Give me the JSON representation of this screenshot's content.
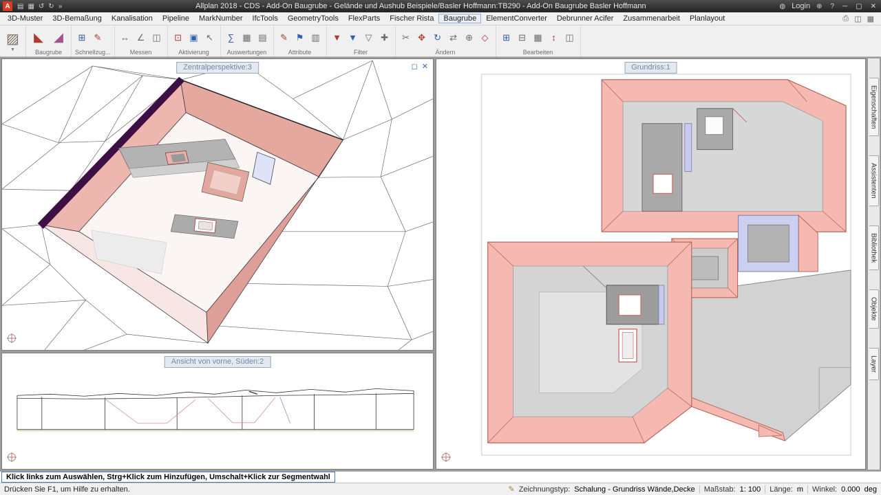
{
  "colors": {
    "wall_pink": "#f6b9b1",
    "wall_salmon": "#e4a89f",
    "rim_purple": "#3d0f45",
    "floor_gray": "#d6d6d6",
    "accent_blue": "#3a6db5",
    "title_tab_bg": "#e2e9f1"
  },
  "titlebar": {
    "title": "Allplan 2018 - CDS - Add-On Baugrube - Gelände und Aushub Beispiele/Basler Hoffmann:TB290 - Add-On Baugrube Basler Hoffmann",
    "login_label": "Login"
  },
  "menubar": {
    "items": [
      "3D-Muster",
      "3D-Bemaßung",
      "Kanalisation",
      "Pipeline",
      "MarkNumber",
      "IfcTools",
      "GeometryTools",
      "FlexParts",
      "Fischer Rista",
      "Baugrube",
      "ElementConverter",
      "Debrunner Acifer",
      "Zusammenarbeit",
      "Planlayout"
    ],
    "active_item": "Baugrube"
  },
  "toolbar": {
    "groups": [
      {
        "label": "Baugrube"
      },
      {
        "label": "Schnellzug..."
      },
      {
        "label": "Messen"
      },
      {
        "label": "Aktivierung"
      },
      {
        "label": "Auswertungen"
      },
      {
        "label": "Attribute"
      },
      {
        "label": "Filter"
      },
      {
        "label": "Ändern"
      },
      {
        "label": "Bearbeiten"
      }
    ]
  },
  "viewports": {
    "perspective": {
      "title": "Zentralperspektive:3"
    },
    "front": {
      "title": "Ansicht von vorne, Süden:2"
    },
    "plan": {
      "title": "Grundriss:1"
    }
  },
  "side_tabs": {
    "items": [
      "Eigenschaften",
      "Assistenten",
      "Bibliothek",
      "Objekte",
      "Layer"
    ]
  },
  "hintbar": {
    "text": "Klick links zum Auswählen, Strg+Klick zum Hinzufügen, Umschalt+Klick zur Segmentwahl"
  },
  "statusbar": {
    "help": "Drücken Sie F1, um Hilfe zu erhalten.",
    "drawing_type_label": "Zeichnungstyp:",
    "drawing_type_value": "Schalung  -  Grundriss Wände,Decke",
    "scale_label": "Maßstab:",
    "scale_value": "1: 100",
    "length_label": "Länge:",
    "length_value": "m",
    "angle_label": "Winkel:",
    "angle_value": "0.000",
    "angle_unit": "deg"
  }
}
